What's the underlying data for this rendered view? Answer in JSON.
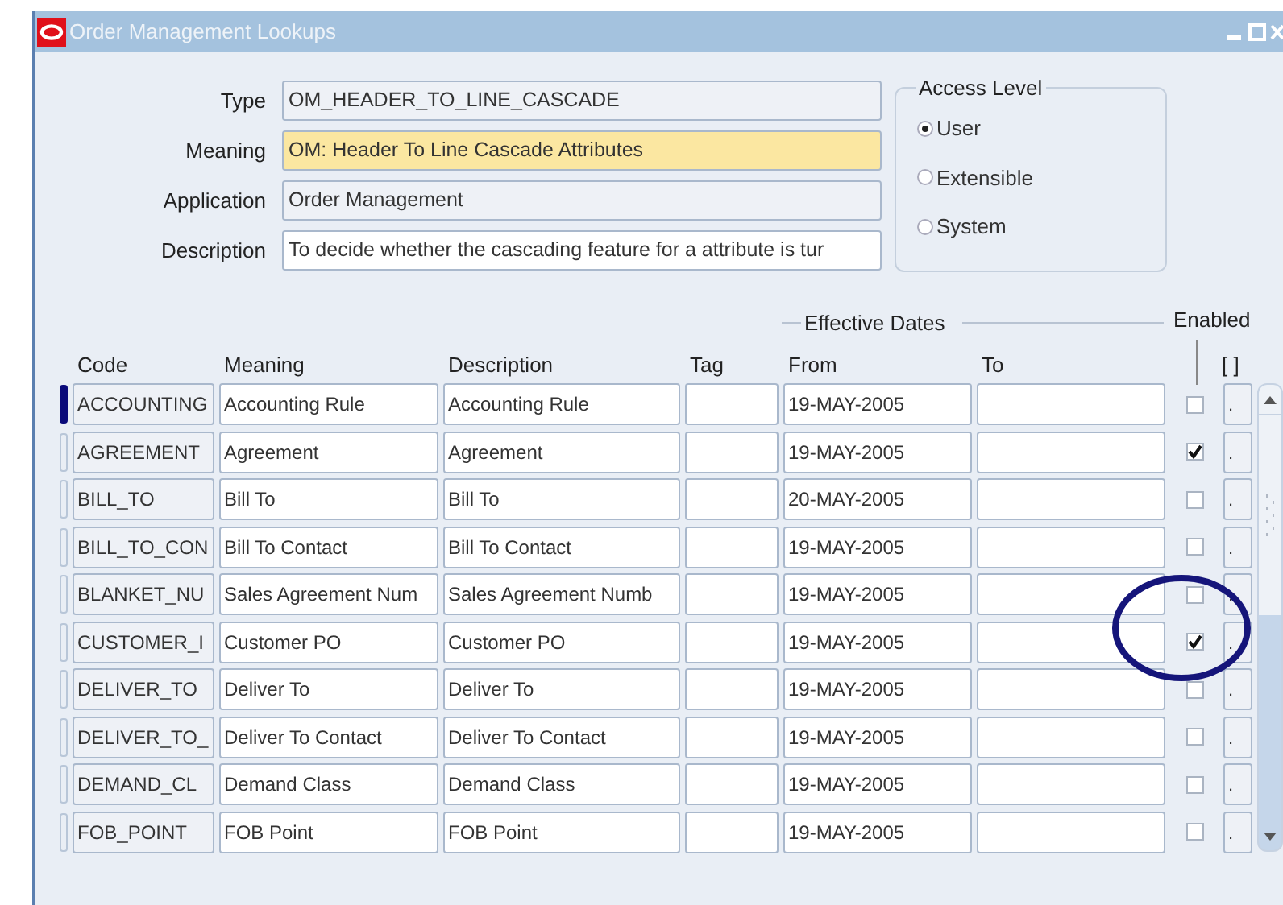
{
  "window": {
    "title": "Order Management Lookups"
  },
  "fields": [
    {
      "label": "Type",
      "value": "OM_HEADER_TO_LINE_CASCADE",
      "kind": "readonly"
    },
    {
      "label": "Meaning",
      "value": "OM: Header To Line Cascade Attributes",
      "kind": "current"
    },
    {
      "label": "Application",
      "value": "Order Management",
      "kind": "readonly"
    },
    {
      "label": "Description",
      "value": "To decide whether the cascading feature for a attribute is tur",
      "kind": "editable"
    }
  ],
  "access_level": {
    "title": "Access Level",
    "options": [
      {
        "label": "User",
        "selected": true
      },
      {
        "label": "Extensible",
        "selected": false
      },
      {
        "label": "System",
        "selected": false
      }
    ]
  },
  "table": {
    "group_header": "Effective Dates",
    "enabled_header": "Enabled",
    "flex_header": "[ ]",
    "columns": [
      "Code",
      "Meaning",
      "Description",
      "Tag",
      "From",
      "To"
    ],
    "rows": [
      {
        "code": "ACCOUNTING",
        "meaning": "Accounting Rule",
        "description": "Accounting Rule",
        "from": "19-MAY-2005",
        "enabled": false,
        "selected": true,
        "button": "."
      },
      {
        "code": "AGREEMENT",
        "meaning": "Agreement",
        "description": "Agreement",
        "from": "19-MAY-2005",
        "enabled": true,
        "selected": false,
        "button": "."
      },
      {
        "code": "BILL_TO",
        "meaning": "Bill To",
        "description": "Bill To",
        "from": "20-MAY-2005",
        "enabled": false,
        "selected": false,
        "button": "."
      },
      {
        "code": "BILL_TO_CON",
        "meaning": "Bill To Contact",
        "description": "Bill To Contact",
        "from": "19-MAY-2005",
        "enabled": false,
        "selected": false,
        "button": "."
      },
      {
        "code": "BLANKET_NU",
        "meaning": "Sales Agreement Num",
        "description": "Sales Agreement Numb",
        "from": "19-MAY-2005",
        "enabled": false,
        "selected": false,
        "button": "."
      },
      {
        "code": "CUSTOMER_I",
        "meaning": "Customer PO",
        "description": "Customer PO",
        "from": "19-MAY-2005",
        "enabled": true,
        "selected": false,
        "button": "."
      },
      {
        "code": "DELIVER_TO",
        "meaning": "Deliver To",
        "description": "Deliver To",
        "from": "19-MAY-2005",
        "enabled": false,
        "selected": false,
        "button": "."
      },
      {
        "code": "DELIVER_TO_",
        "meaning": "Deliver To Contact",
        "description": "Deliver To Contact",
        "from": "19-MAY-2005",
        "enabled": false,
        "selected": false,
        "button": "."
      },
      {
        "code": "DEMAND_CL",
        "meaning": "Demand Class",
        "description": "Demand Class",
        "from": "19-MAY-2005",
        "enabled": false,
        "selected": false,
        "button": "."
      },
      {
        "code": "FOB_POINT",
        "meaning": "FOB Point",
        "description": "FOB Point",
        "from": "19-MAY-2005",
        "enabled": false,
        "selected": false,
        "button": "."
      }
    ]
  }
}
